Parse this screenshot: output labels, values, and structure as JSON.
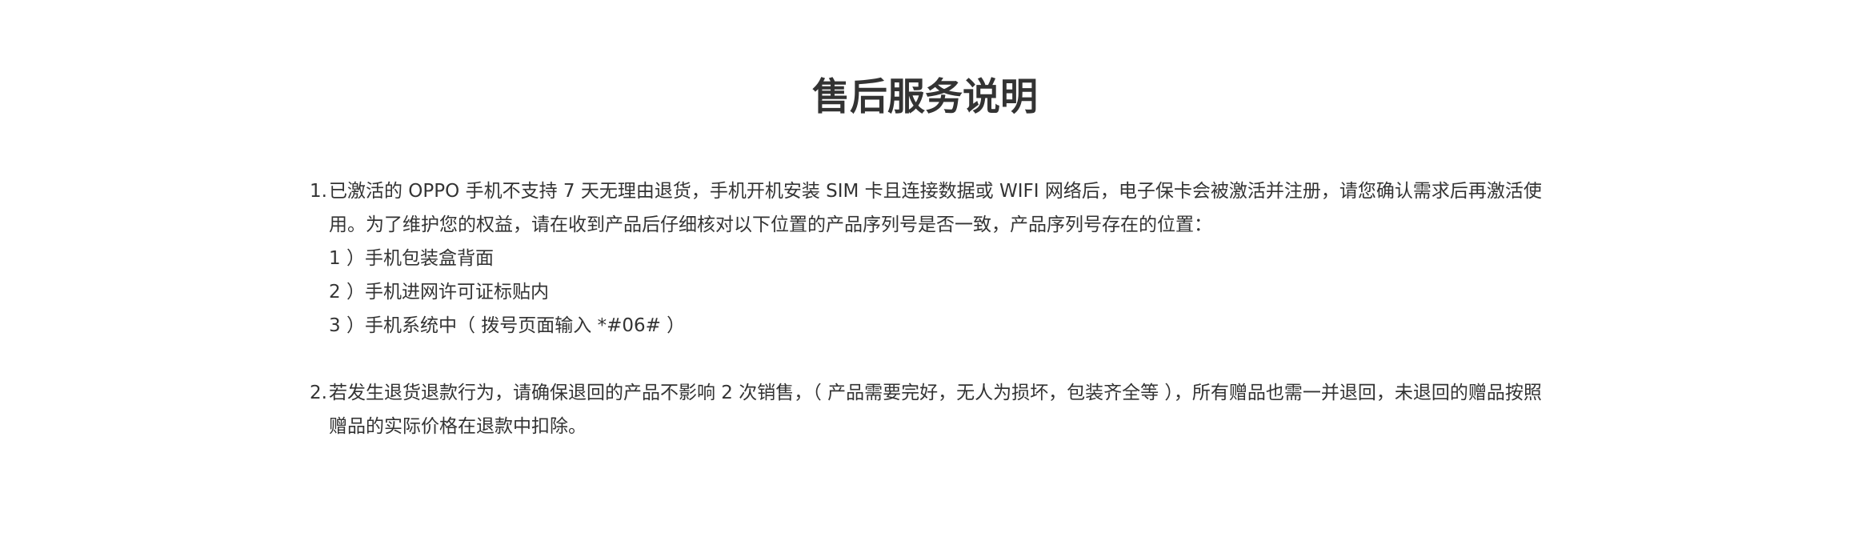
{
  "title": "售后服务说明",
  "sections": [
    {
      "number": "1.",
      "text": "已激活的 OPPO 手机不支持 7 天无理由退货，手机开机安装 SIM 卡且连接数据或 WIFI 网络后，电子保卡会被激活并注册，请您确认需求后再激活使用。为了维护您的权益，请在收到产品后仔细核对以下位置的产品序列号是否一致，产品序列号存在的位置：",
      "sub_items": [
        "1 ）手机包装盒背面",
        "2 ）手机进网许可证标贴内",
        "3 ）手机系统中（ 拨号页面输入 *#06# ）"
      ]
    },
    {
      "number": "2.",
      "text": "若发生退货退款行为，请确保退回的产品不影响 2 次销售，（ 产品需要完好，无人为损坏，包装齐全等 ），所有赠品也需一并退回，未退回的赠品按照赠品的实际价格在退款中扣除。"
    }
  ]
}
